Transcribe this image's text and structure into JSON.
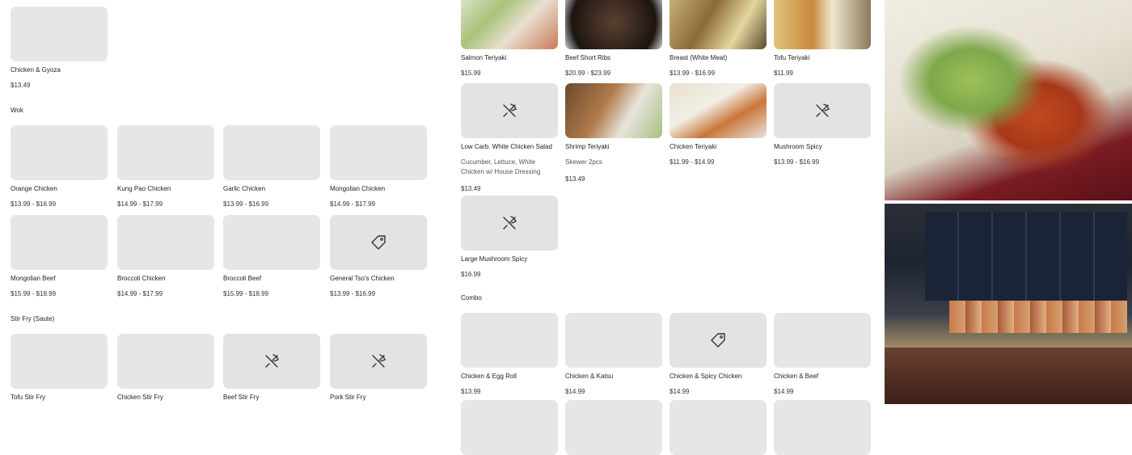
{
  "icons": {
    "placeholder": "fork-knife-icon",
    "tag": "tag-icon"
  },
  "left": {
    "top_item": {
      "name": "Chicken & Gyoza",
      "price": "$13.49"
    },
    "wok": {
      "title": "Wok",
      "items": [
        {
          "name": "Orange Chicken",
          "price": "$13.99 - $16.99"
        },
        {
          "name": "Kung Pao Chicken",
          "price": "$14.99 - $17.99"
        },
        {
          "name": "Garlic Chicken",
          "price": "$13.99 - $16.99"
        },
        {
          "name": "Mongolian Chicken",
          "price": "$14.99 - $17.99"
        },
        {
          "name": "Mongolian Beef",
          "price": "$15.99 - $18.99"
        },
        {
          "name": "Broccoli Chicken",
          "price": "$14.99 - $17.99"
        },
        {
          "name": "Broccoli Beef",
          "price": "$15.99 - $18.99"
        },
        {
          "name": "General Tso's Chicken",
          "price": "$13.99 - $16.99"
        }
      ]
    },
    "stirfry": {
      "title": "Stir Fry (Saute)",
      "items": [
        {
          "name": "Tofu Stir Fry"
        },
        {
          "name": "Chicken Stir Fry"
        },
        {
          "name": "Beef Stir Fry"
        },
        {
          "name": "Pork Stir Fry"
        }
      ]
    }
  },
  "mid": {
    "teriyaki": [
      {
        "name": "Salmon Teriyaki",
        "price": "$15.99"
      },
      {
        "name": "Beef Short Ribs",
        "price": "$20.99 - $23.99"
      },
      {
        "name": "Breast (White Meat)",
        "price": "$13.99 - $16.99"
      },
      {
        "name": "Tofu Teriyaki",
        "price": "$11.99"
      },
      {
        "name": "Low Carb. White Chicken Salad",
        "desc": "Cucumber, Lettuce, White Chicken w/ House Dressing",
        "price": "$13.49"
      },
      {
        "name": "Shrimp Teriyaki",
        "desc": "Skewer 2pcs",
        "price": "$13.49"
      },
      {
        "name": "Chicken Teriyaki",
        "price": "$11.99 - $14.99"
      },
      {
        "name": "Mushroom Spicy",
        "price": "$13.99 - $16.99"
      },
      {
        "name": "Large Mushroom Spicy",
        "price": "$16.99"
      }
    ],
    "combo": {
      "title": "Combo",
      "items": [
        {
          "name": "Chicken & Egg Roll",
          "price": "$13.99"
        },
        {
          "name": "Chicken & Katsu",
          "price": "$14.99"
        },
        {
          "name": "Chicken & Spicy Chicken",
          "price": "$14.99"
        },
        {
          "name": "Chicken & Beef",
          "price": "$14.99"
        }
      ]
    }
  }
}
